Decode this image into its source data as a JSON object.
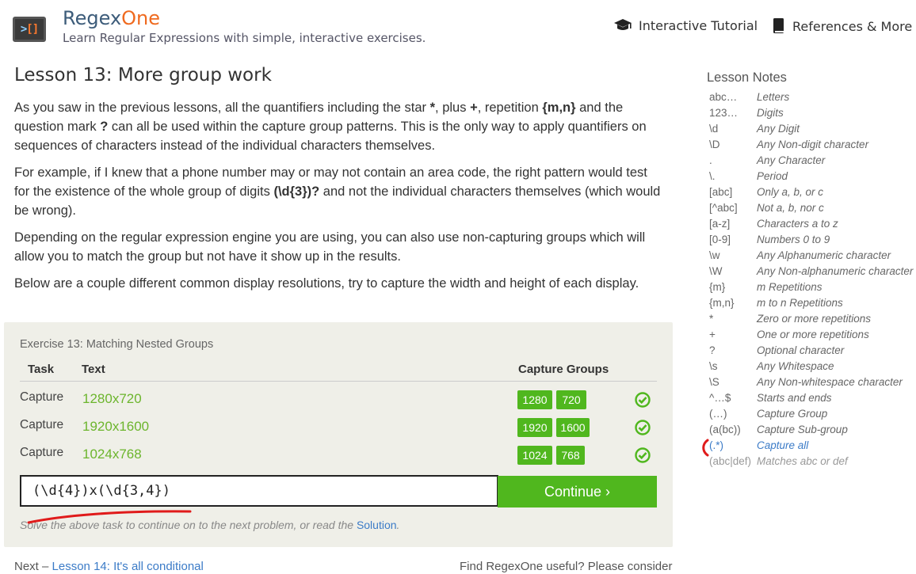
{
  "header": {
    "brand_prefix": "Regex",
    "brand_suffix": "One",
    "tagline": "Learn Regular Expressions with simple, interactive exercises.",
    "nav": [
      {
        "label": "Interactive Tutorial",
        "icon": "graduation-cap-icon"
      },
      {
        "label": "References & More",
        "icon": "book-icon"
      }
    ]
  },
  "lesson": {
    "title": "Lesson 13: More group work",
    "p1": {
      "a": "As you saw in the previous lessons, all the quantifiers including the star ",
      "b": "*",
      "c": ", plus ",
      "d": "+",
      "e": ", repetition ",
      "f": "{m,n}",
      "g": " and the question mark ",
      "h": "?",
      "i": " can all be used within the capture group patterns. This is the only way to apply quantifiers on sequences of characters instead of the individual characters themselves."
    },
    "p2": {
      "a": "For example, if I knew that a phone number may or may not contain an area code, the right pattern would test for the existence of the whole group of digits ",
      "b": "(\\d{3})?",
      "c": " and not the individual characters themselves (which would be wrong)."
    },
    "p3": "Depending on the regular expression engine you are using, you can also use non-capturing groups which will allow you to match the group but not have it show up in the results.",
    "p4": "Below are a couple different common display resolutions, try to capture the width and height of each display."
  },
  "exercise": {
    "title": "Exercise 13: Matching Nested Groups",
    "headers": {
      "task": "Task",
      "text": "Text",
      "groups": "Capture Groups"
    },
    "rows": [
      {
        "task": "Capture",
        "text": "1280x720",
        "g1": "1280",
        "g2": "720"
      },
      {
        "task": "Capture",
        "text": "1920x1600",
        "g1": "1920",
        "g2": "1600"
      },
      {
        "task": "Capture",
        "text": "1024x768",
        "g1": "1024",
        "g2": "768"
      }
    ],
    "input_value": "(\\d{4})x(\\d{3,4})",
    "continue_label": "Continue ›",
    "hint_prefix": "Solve the above task to continue on to the next problem, or read the ",
    "hint_link": "Solution",
    "hint_suffix": ".",
    "colors": {
      "success": "#50b71e",
      "text_green": "#6cb52d"
    }
  },
  "footer": {
    "next_prefix": "Next – ",
    "next_link": "Lesson 14: It's all conditional",
    "right_text": "Find RegexOne useful? Please consider"
  },
  "notes": {
    "title": "Lesson Notes",
    "items": [
      {
        "k": "abc…",
        "v": "Letters"
      },
      {
        "k": "123…",
        "v": "Digits"
      },
      {
        "k": "\\d",
        "v": "Any Digit"
      },
      {
        "k": "\\D",
        "v": "Any Non-digit character"
      },
      {
        "k": ".",
        "v": "Any Character"
      },
      {
        "k": "\\.",
        "v": "Period"
      },
      {
        "k": "[abc]",
        "v": "Only a, b, or c"
      },
      {
        "k": "[^abc]",
        "v": "Not a, b, nor c"
      },
      {
        "k": "[a-z]",
        "v": "Characters a to z"
      },
      {
        "k": "[0-9]",
        "v": "Numbers 0 to 9"
      },
      {
        "k": "\\w",
        "v": "Any Alphanumeric character"
      },
      {
        "k": "\\W",
        "v": "Any Non-alphanumeric character"
      },
      {
        "k": "{m}",
        "v": "m Repetitions"
      },
      {
        "k": "{m,n}",
        "v": "m to n Repetitions"
      },
      {
        "k": "*",
        "v": "Zero or more repetitions"
      },
      {
        "k": "+",
        "v": "One or more repetitions"
      },
      {
        "k": "?",
        "v": "Optional character"
      },
      {
        "k": "\\s",
        "v": "Any Whitespace"
      },
      {
        "k": "\\S",
        "v": "Any Non-whitespace character"
      },
      {
        "k": "^…$",
        "v": "Starts and ends"
      },
      {
        "k": "(…)",
        "v": "Capture Group"
      },
      {
        "k": "(a(bc))",
        "v": "Capture Sub-group"
      },
      {
        "k": "(.*)",
        "v": "Capture all"
      },
      {
        "k": "(abc|def)",
        "v": "Matches abc or def"
      }
    ]
  }
}
